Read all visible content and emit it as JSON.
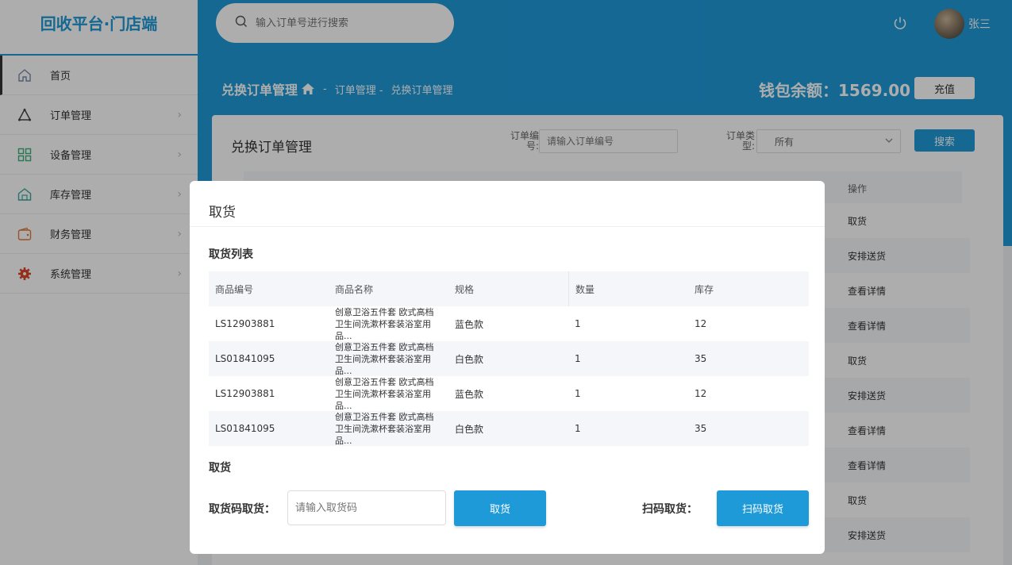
{
  "app": {
    "title": "回收平台·门店端"
  },
  "sidebar": {
    "items": [
      {
        "label": "首页",
        "icon": "home-icon",
        "color": "#7a8aa8"
      },
      {
        "label": "订单管理",
        "icon": "triangle-icon",
        "color": "#444444"
      },
      {
        "label": "设备管理",
        "icon": "grid-icon",
        "color": "#37b27a"
      },
      {
        "label": "库存管理",
        "icon": "warehouse-icon",
        "color": "#3aa8a0"
      },
      {
        "label": "财务管理",
        "icon": "wallet-icon",
        "color": "#e07a3a"
      },
      {
        "label": "系统管理",
        "icon": "gear-icon",
        "color": "#d9482b"
      }
    ]
  },
  "header": {
    "search_placeholder": "输入订单号进行搜索",
    "user_name": "张三",
    "breadcrumb": {
      "current": "兑换订单管理",
      "sep": "-",
      "link1": "订单管理 -",
      "link2": "兑换订单管理"
    },
    "wallet": "钱包余额：1569.00",
    "recharge": "充值"
  },
  "card": {
    "title": "兑换订单管理",
    "order_no_label": "订单编号:",
    "order_no_placeholder": "请输入订单编号",
    "order_type_label": "订单类型:",
    "order_type_value": "所有",
    "search_button": "搜索",
    "op_header": "操作",
    "row_actions": [
      "取货",
      "安排送货",
      "查看详情",
      "查看详情",
      "取货",
      "安排送货",
      "查看详情",
      "查看详情",
      "取货",
      "安排送货"
    ]
  },
  "modal": {
    "title": "取货",
    "list_title": "取货列表",
    "columns": [
      "商品编号",
      "商品名称",
      "规格",
      "数量",
      "库存"
    ],
    "rows": [
      [
        "LS12903881",
        "创意卫浴五件套 欧式高档卫生间洗漱杯套装浴室用品...",
        "蓝色款",
        "1",
        "12"
      ],
      [
        "LS01841095",
        "创意卫浴五件套 欧式高档卫生间洗漱杯套装浴室用品...",
        "白色款",
        "1",
        "35"
      ],
      [
        "LS12903881",
        "创意卫浴五件套 欧式高档卫生间洗漱杯套装浴室用品...",
        "蓝色款",
        "1",
        "12"
      ],
      [
        "LS01841095",
        "创意卫浴五件套 欧式高档卫生间洗漱杯套装浴室用品...",
        "白色款",
        "1",
        "35"
      ]
    ],
    "pickup_title": "取货",
    "code_label": "取货码取货：",
    "code_placeholder": "请输入取货码",
    "pickup_button": "取货",
    "scan_label": "扫码取货：",
    "scan_button": "扫码取货"
  }
}
